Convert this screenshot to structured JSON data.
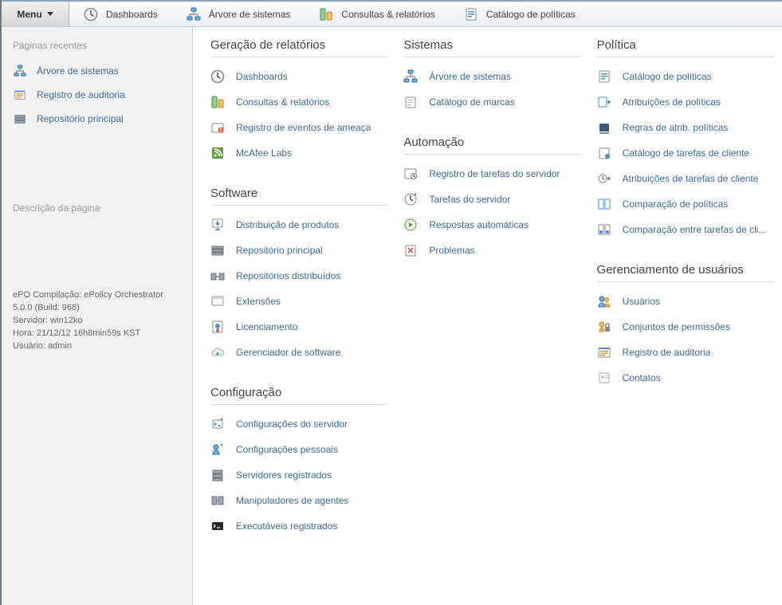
{
  "topbar": {
    "menu_label": "Menu",
    "links": [
      {
        "icon": "clock",
        "label": "Dashboards"
      },
      {
        "icon": "tree",
        "label": "Árvore de sistemas"
      },
      {
        "icon": "reports",
        "label": "Consultas & relatórios"
      },
      {
        "icon": "policy",
        "label": "Catálogo de políticas"
      }
    ]
  },
  "sidebar": {
    "recent_heading": "Páginas recentes",
    "recent": [
      {
        "icon": "tree",
        "label": "Árvore de sistemas"
      },
      {
        "icon": "audit",
        "label": "Registro de auditoria"
      },
      {
        "icon": "repo",
        "label": "Repositório principal"
      }
    ],
    "desc_heading": "Descrição da página",
    "footer": {
      "line1": "ePO Compilação: ePolicy Orchestrator",
      "line2": "5.0.0 (Build: 968)",
      "line3": "Servidor: win12ko",
      "line4": "Hora: 21/12/12 16h8min59s KST",
      "line5": "Usuário: admin"
    }
  },
  "sections": {
    "col1": [
      {
        "title": "Geração de relatórios",
        "items": [
          {
            "icon": "clock",
            "label": "Dashboards"
          },
          {
            "icon": "reports",
            "label": "Consultas & relatórios"
          },
          {
            "icon": "threat",
            "label": "Registro de eventos de ameaça"
          },
          {
            "icon": "rss",
            "label": "McAfee Labs"
          }
        ]
      },
      {
        "title": "Software",
        "items": [
          {
            "icon": "download",
            "label": "Distribuição de produtos"
          },
          {
            "icon": "repo",
            "label": "Repositório principal"
          },
          {
            "icon": "distrepo",
            "label": "Repositórios distribuídos"
          },
          {
            "icon": "ext",
            "label": "Extensões"
          },
          {
            "icon": "license",
            "label": "Licenciamento"
          },
          {
            "icon": "cloud",
            "label": "Gerenciador de software"
          }
        ]
      },
      {
        "title": "Configuração",
        "items": [
          {
            "icon": "srvcfg",
            "label": "Configurações do servidor"
          },
          {
            "icon": "usercfg",
            "label": "Configurações pessoais"
          },
          {
            "icon": "regsrv",
            "label": "Servidores registrados"
          },
          {
            "icon": "agents",
            "label": "Manipuladores de agentes"
          },
          {
            "icon": "exec",
            "label": "Executáveis registrados"
          }
        ]
      }
    ],
    "col2": [
      {
        "title": "Sistemas",
        "items": [
          {
            "icon": "tree",
            "label": "Árvore de sistemas"
          },
          {
            "icon": "catalog",
            "label": "Catálogo de marcas"
          }
        ]
      },
      {
        "title": "Automação",
        "items": [
          {
            "icon": "tasklog",
            "label": "Registro de tarefas do servidor"
          },
          {
            "icon": "tasks",
            "label": "Tarefas do servidor"
          },
          {
            "icon": "play",
            "label": "Respostas automáticas"
          },
          {
            "icon": "problems",
            "label": "Problemas"
          }
        ]
      }
    ],
    "col3": [
      {
        "title": "Política",
        "items": [
          {
            "icon": "policy",
            "label": "Catálogo de políticas"
          },
          {
            "icon": "polassign",
            "label": "Atribuições de políticas"
          },
          {
            "icon": "polrules",
            "label": "Regras de atrib. políticas"
          },
          {
            "icon": "taskcat",
            "label": "Catálogo de tarefas de cliente"
          },
          {
            "icon": "taskassign",
            "label": "Atribuições de tarefas de cliente"
          },
          {
            "icon": "polcompare",
            "label": "Comparação de políticas"
          },
          {
            "icon": "taskcompare",
            "label": "Comparação entre tarefas de cli..."
          }
        ]
      },
      {
        "title": "Gerenciamento de usuários",
        "items": [
          {
            "icon": "users",
            "label": "Usuários"
          },
          {
            "icon": "perms",
            "label": "Conjuntos de permissões"
          },
          {
            "icon": "audit",
            "label": "Registro de auditoria"
          },
          {
            "icon": "contacts",
            "label": "Contatos"
          }
        ]
      }
    ]
  }
}
